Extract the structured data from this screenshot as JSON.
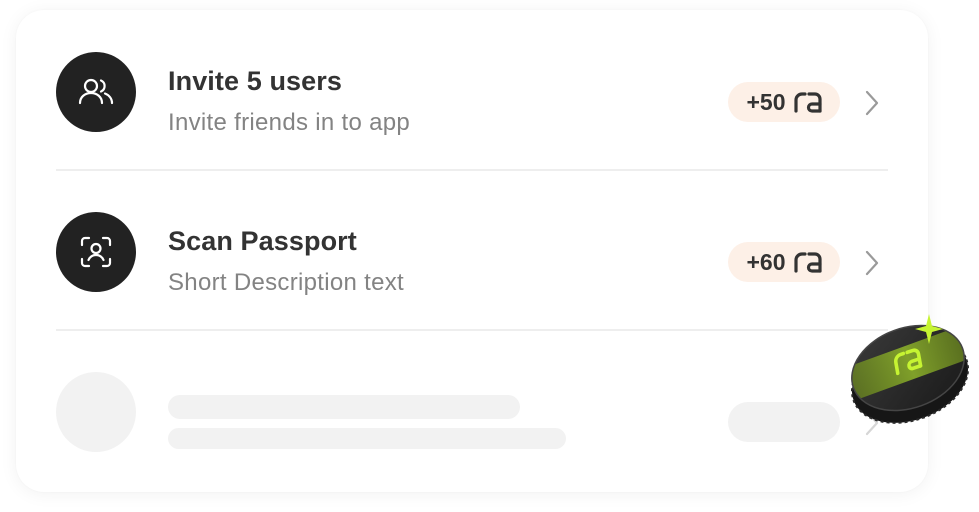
{
  "tasks": [
    {
      "title": "Invite 5 users",
      "description": "Invite friends in to app",
      "reward": "+50",
      "icon": "users-icon"
    },
    {
      "title": "Scan Passport",
      "description": "Short Description text",
      "reward": "+60",
      "icon": "scan-face-icon"
    }
  ],
  "token": {
    "glyph": "ra",
    "icon": "ra-token-icon"
  },
  "loading_row": {
    "state": "skeleton"
  },
  "colors": {
    "avatar_bg": "#222222",
    "badge_bg": "#fdf0e7",
    "title_text": "#333333",
    "description_text": "#838383",
    "skeleton": "#f2f2f2",
    "coin_accent": "#c6f432"
  }
}
